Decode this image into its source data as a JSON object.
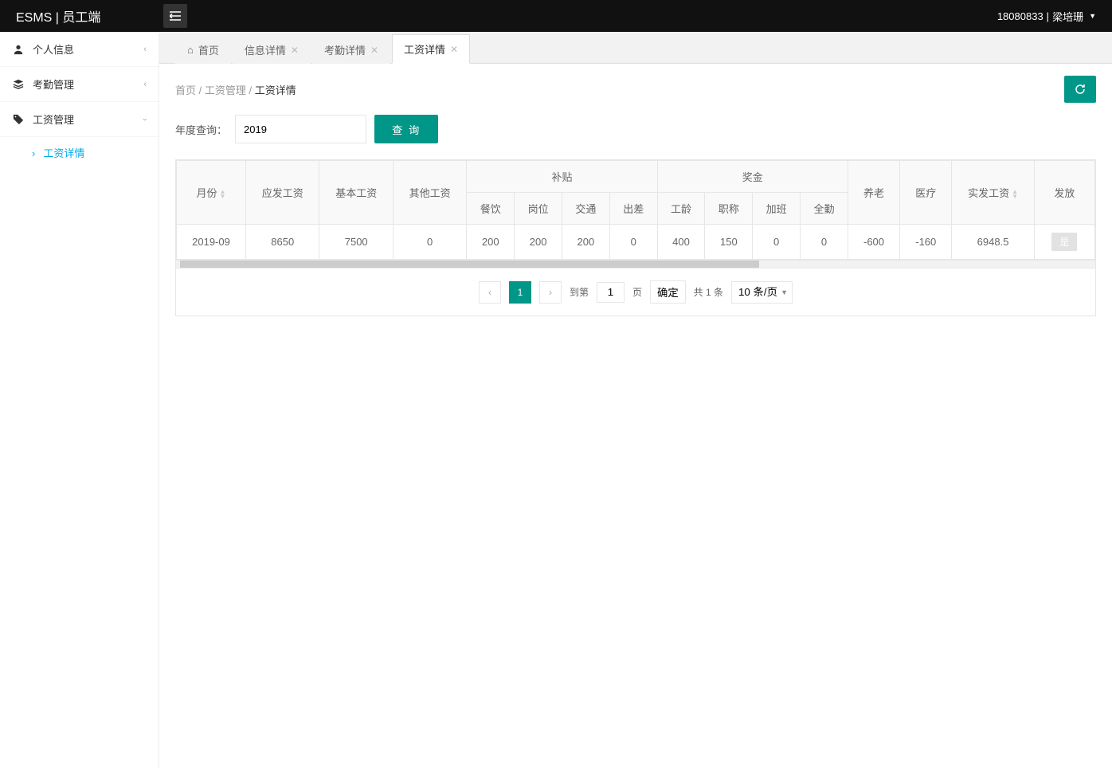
{
  "header": {
    "logo": "ESMS | 员工端",
    "user_id": "18080833",
    "user_name": "梁培珊"
  },
  "sidebar": {
    "items": [
      {
        "icon": "person",
        "label": "个人信息",
        "expanded": false
      },
      {
        "icon": "layers",
        "label": "考勤管理",
        "expanded": false
      },
      {
        "icon": "tag",
        "label": "工资管理",
        "expanded": true
      }
    ],
    "submenu": {
      "salary_detail": "工资详情"
    }
  },
  "tabs": {
    "home": "首页",
    "info": "信息详情",
    "attendance": "考勤详情",
    "salary": "工资详情"
  },
  "breadcrumb": {
    "home": "首页",
    "mgmt": "工资管理",
    "current": "工资详情",
    "sep": " / "
  },
  "query": {
    "label": "年度查询：",
    "value": "2019",
    "button": "查 询"
  },
  "table": {
    "group_month": "月份",
    "group_yingfa": "应发工资",
    "group_basic": "基本工资",
    "group_other": "其他工资",
    "group_butie": "补贴",
    "group_bonus": "奖金",
    "group_shifa": "实发工资",
    "group_fafang": "发放",
    "sub": {
      "c1": "餐饮",
      "c2": "岗位",
      "c3": "交通",
      "c4": "出差",
      "b1": "工龄",
      "b2": "职称",
      "b3": "加班",
      "b4": "全勤",
      "d1": "养老",
      "d2": "医疗"
    },
    "row": {
      "month": "2019-09",
      "yingfa": "8650",
      "basic": "7500",
      "other": "0",
      "c1": "200",
      "c2": "200",
      "c3": "200",
      "c4": "0",
      "b1": "400",
      "b2": "150",
      "b3": "0",
      "b4": "0",
      "d1": "-600",
      "d2": "-160",
      "shifa": "6948.5",
      "fafang": "是"
    }
  },
  "pager": {
    "page": "1",
    "goto_label": "到第",
    "goto_value": "1",
    "page_unit": "页",
    "confirm": "确定",
    "total": "共 1 条",
    "perpage": "10 条/页"
  }
}
